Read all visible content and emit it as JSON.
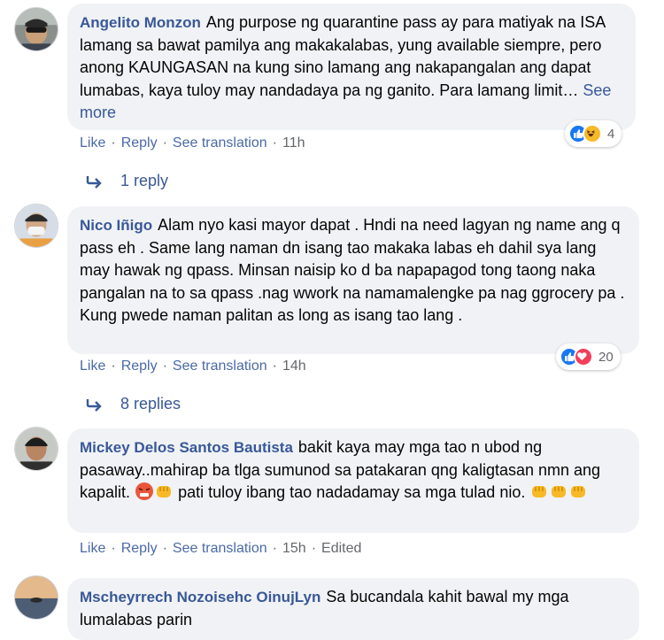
{
  "comments": [
    {
      "author": "Angelito Monzon",
      "text": "Ang purpose ng quarantine pass ay para matiyak na ISA lamang sa bawat pamilya ang makakalabas, yung available siempre, pero anong KAUNGASAN na kung sino lamang ang nakapangalan ang dapat lumabas, kaya tuloy may nandadaya pa ng ganito. Para lamang limit…",
      "see_more": "See more",
      "like": "Like",
      "reply": "Reply",
      "translate": "See translation",
      "time": "11h",
      "reaction_count": "4",
      "reaction_icons": [
        "like-reaction-icon",
        "haha-reaction-icon"
      ]
    },
    {
      "author": "Nico Iñigo",
      "text": "Alam nyo kasi mayor dapat . Hndi na need lagyan ng name ang q pass eh . Same lang naman dn isang tao makaka labas eh dahil sya lang may hawak ng qpass. Minsan naisip ko d ba napapagod tong taong naka pangalan na to sa qpass .nag wwork na namamalengke pa nag ggrocery pa . Kung pwede naman palitan as long as isang tao lang .",
      "like": "Like",
      "reply": "Reply",
      "translate": "See translation",
      "time": "14h",
      "reaction_count": "20",
      "reaction_icons": [
        "like-reaction-icon",
        "love-reaction-icon"
      ]
    },
    {
      "author": "Mickey Delos Santos Bautista",
      "text_1": "bakit kaya may mga tao n ubod ng pasaway..mahirap ba tlga sumunod sa patakaran qng kaligtasan nmn ang kapalit.",
      "text_2": "pati tuloy ibang tao nadadamay sa mga tulad nio.",
      "like": "Like",
      "reply": "Reply",
      "translate": "See translation",
      "time": "15h",
      "edited": "Edited"
    },
    {
      "author": "Mscheyrrech Nozoisehc OinujLyn",
      "text": "Sa bucandala kahit bawal my mga lumalabas parin"
    }
  ],
  "replies": [
    {
      "label": "1 reply"
    },
    {
      "label": "8 replies"
    }
  ],
  "colors": {
    "link": "#385898",
    "bubble": "#f0f2f5",
    "meta": "#65676b",
    "like_blue": "#1877f2",
    "love_red": "#f33e58",
    "haha_yellow": "#f7b928"
  }
}
